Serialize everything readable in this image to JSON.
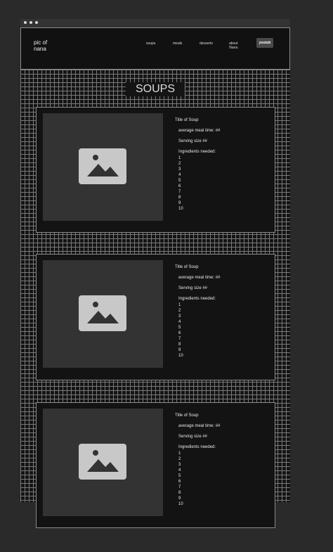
{
  "header": {
    "logo_line1": "pic of",
    "logo_line2": "nana",
    "nav": {
      "soups": "soups",
      "meals": "meals",
      "desserts": "desserts",
      "about_line1": "about",
      "about_line2": "Nana",
      "youtube": "youtub"
    }
  },
  "page": {
    "section_title": "SOUPS"
  },
  "cards": [
    {
      "title": "Title of Soup",
      "meal_time": "average meal time: ##",
      "serving_size": "Serving size ##",
      "ingredients_heading": "Ingredients needed:",
      "ingredients": [
        "1",
        "2",
        "3",
        "4",
        "5",
        "6",
        "7",
        "8",
        "9",
        "10"
      ]
    },
    {
      "title": "Title of Soup",
      "meal_time": "average meal time: ##",
      "serving_size": "Serving size ##",
      "ingredients_heading": "Ingredients needed:",
      "ingredients": [
        "1",
        "2",
        "3",
        "4",
        "5",
        "6",
        "7",
        "8",
        "9",
        "10"
      ]
    },
    {
      "title": "Title of Soup",
      "meal_time": "average meal time: ##",
      "serving_size": "Serving size ##",
      "ingredients_heading": "Ingredients needed:",
      "ingredients": [
        "1",
        "2",
        "3",
        "4",
        "5",
        "6",
        "7",
        "8",
        "9",
        "10"
      ]
    }
  ],
  "icons": {
    "placeholder": "image-placeholder-icon"
  }
}
